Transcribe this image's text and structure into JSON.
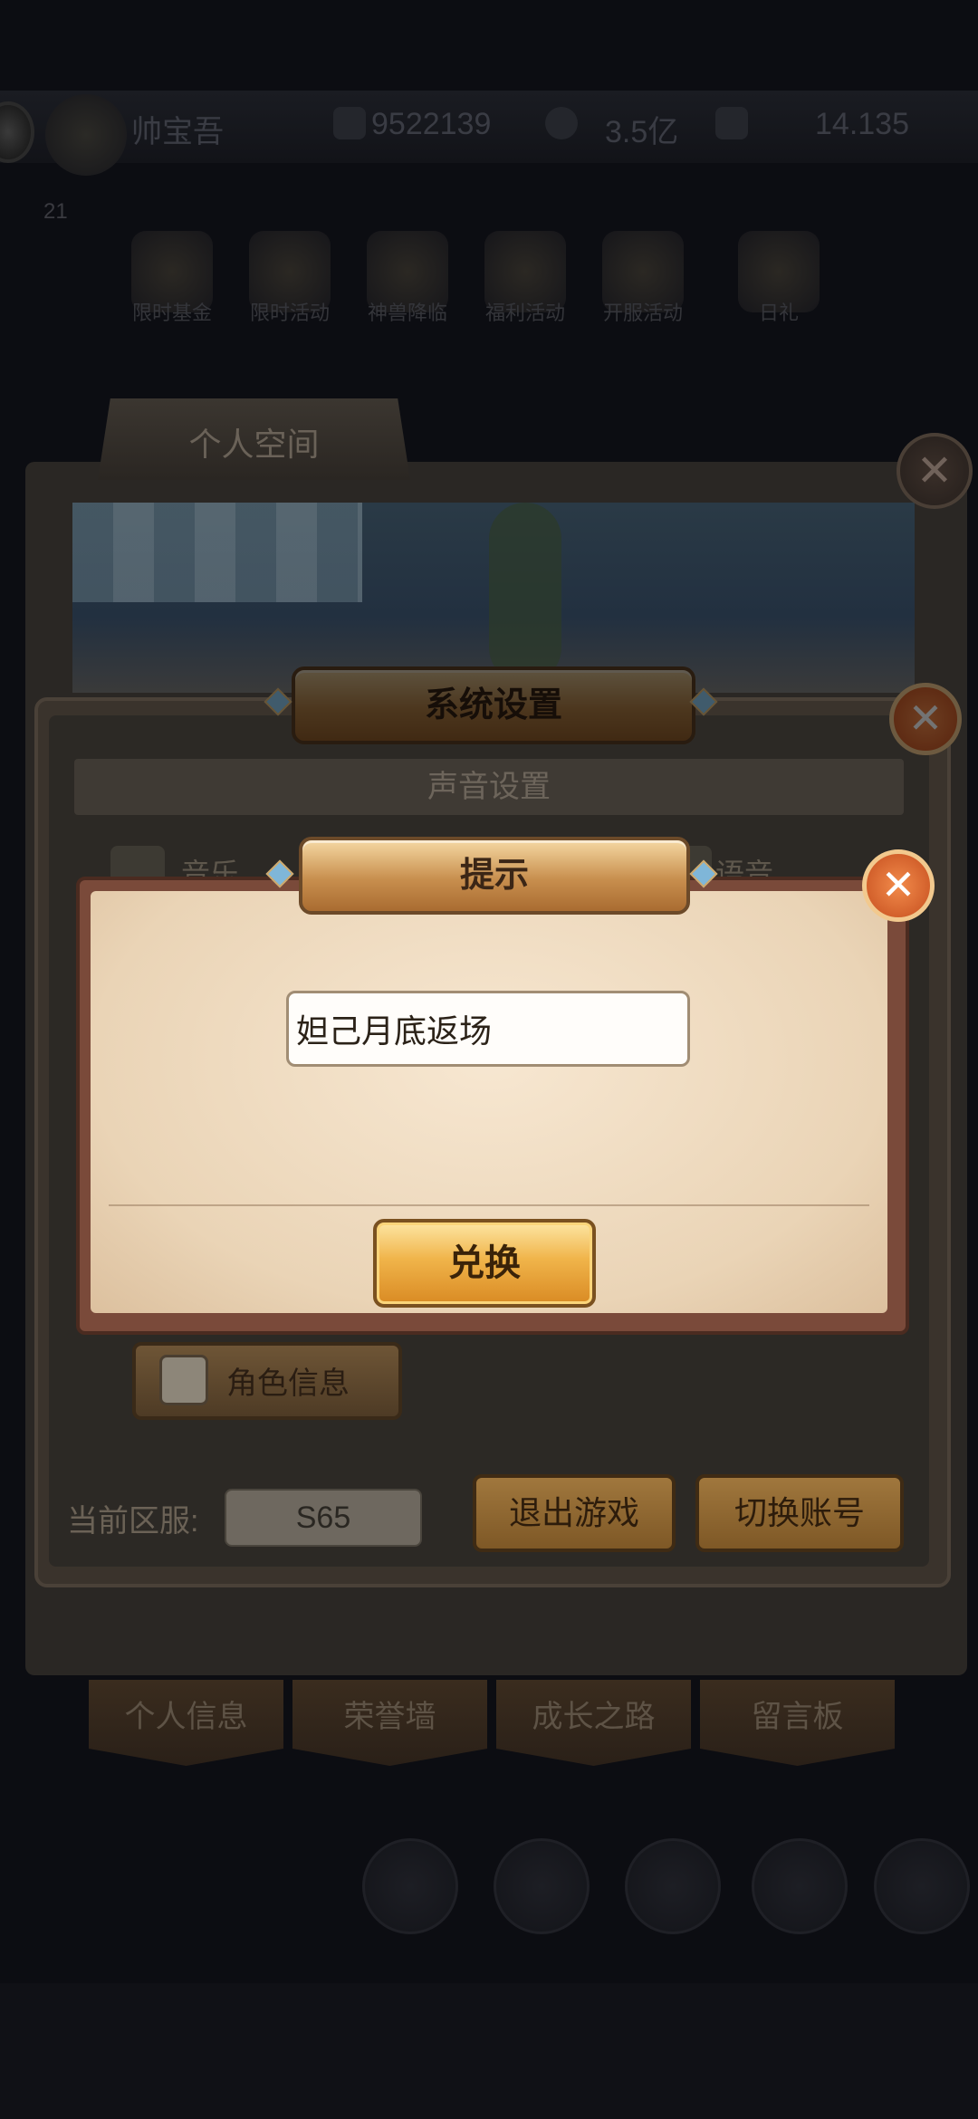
{
  "hud": {
    "player_name": "帅宝吾",
    "level": "21",
    "coins": "9522139",
    "energy": "3.5亿",
    "gems": "14.135"
  },
  "features": [
    {
      "label": "限时基金",
      "icon": "fund-icon"
    },
    {
      "label": "限时活动",
      "icon": "event-icon"
    },
    {
      "label": "神兽降临",
      "icon": "beast-icon"
    },
    {
      "label": "福利活动",
      "icon": "gift-icon"
    },
    {
      "label": "开服活动",
      "icon": "calendar-icon"
    },
    {
      "label": "日礼",
      "icon": "daily-gift-icon"
    }
  ],
  "personal_space": {
    "tab_title": "个人空间",
    "tabs": [
      "个人信息",
      "荣誉墙",
      "成长之路",
      "留言板"
    ]
  },
  "system_settings": {
    "title": "系统设置",
    "sound_section": "声音设置",
    "music_label": "音乐",
    "voice_label": "语音",
    "role_info_button": "角色信息",
    "server_label": "当前区服:",
    "server_value": "S65",
    "quit_button": "退出游戏",
    "switch_account_button": "切换账号"
  },
  "tip_dialog": {
    "title": "提示",
    "input_value": "妲己月底返场",
    "exchange_button": "兑换"
  },
  "colors": {
    "banner_gold": "#c88f4e",
    "close_orange": "#e0692f",
    "exchange_gold": "#f0b44a"
  }
}
